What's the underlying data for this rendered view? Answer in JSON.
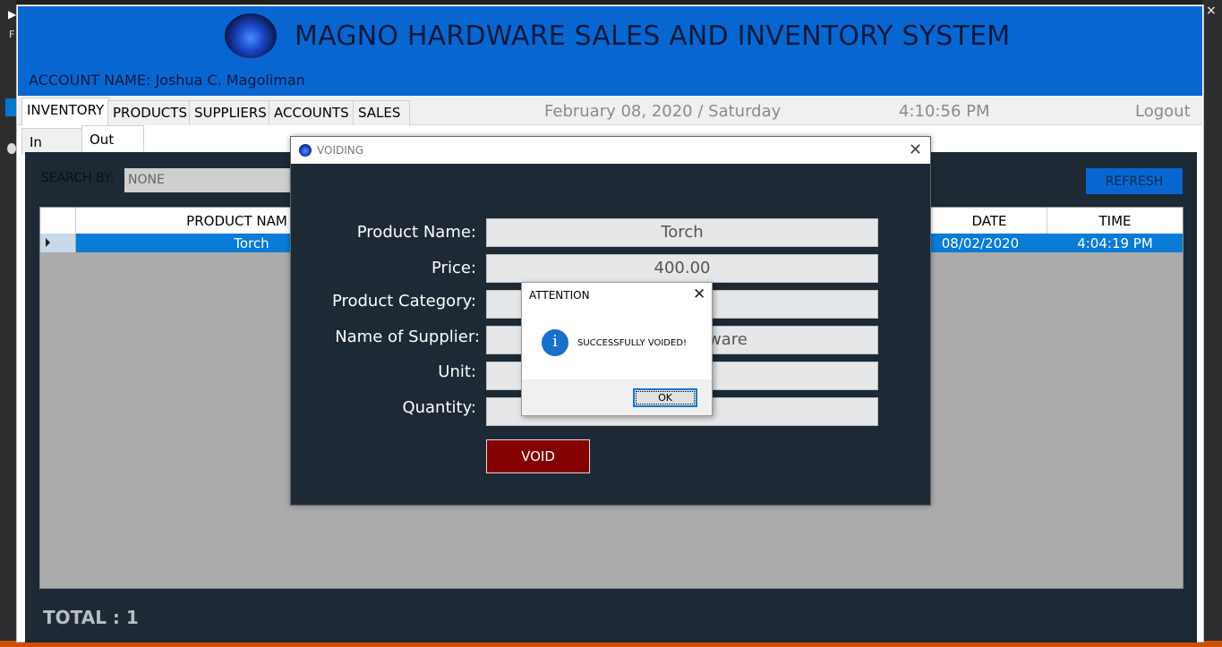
{
  "window": {
    "title": "MAGNO HARDWARE SALES AND INVENTORY SYSTEM",
    "account_label": "ACCOUNT NAME: Joshua C. Magoliman"
  },
  "tabs": [
    "INVENTORY",
    "PRODUCTS",
    "SUPPLIERS",
    "ACCOUNTS",
    "SALES"
  ],
  "status": {
    "date": "February 08, 2020 / Saturday",
    "time": "4:10:56 PM",
    "logout": "Logout"
  },
  "subtabs": [
    "In",
    "Out"
  ],
  "search": {
    "label": "SEARCH BY:",
    "value": "NONE"
  },
  "refresh_label": "REFRESH",
  "grid": {
    "headers": {
      "product_name": "PRODUCT NAM",
      "date": "DATE",
      "time": "TIME"
    },
    "rows": [
      {
        "product_name": "Torch",
        "date": "08/02/2020",
        "time": "4:04:19 PM"
      }
    ]
  },
  "total_label": "TOTAL : 1",
  "voiding": {
    "title": "VOIDING",
    "fields": [
      {
        "label": "Product Name:",
        "value": "Torch"
      },
      {
        "label": "Price:",
        "value": "400.00"
      },
      {
        "label": "Product Category:",
        "value": ""
      },
      {
        "label": "Name of Supplier:",
        "value": "ware"
      },
      {
        "label": "Unit:",
        "value": ""
      },
      {
        "label": "Quantity:",
        "value": ""
      }
    ],
    "void_label": "VOID"
  },
  "attention": {
    "title": "ATTENTION",
    "message": "SUCCESSFULLY VOIDED!",
    "ok_label": "OK",
    "icon": "info-icon"
  },
  "colors": {
    "header_blue": "#0866d1",
    "panel_dark": "#1d2935",
    "void_red": "#850000",
    "row_selected": "#0a7bd6"
  }
}
